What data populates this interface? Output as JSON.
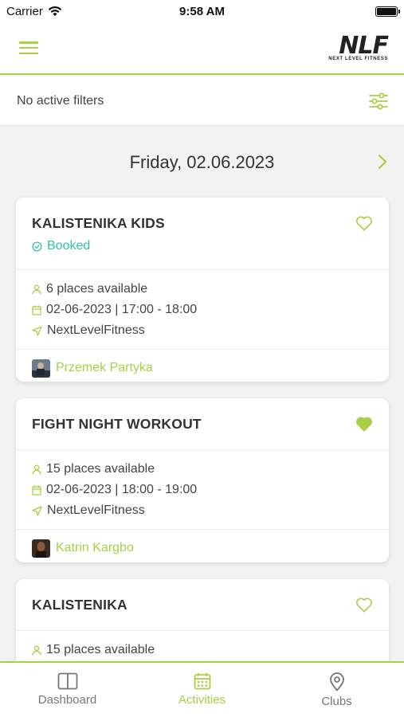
{
  "status_bar": {
    "carrier": "Carrier",
    "time": "9:58 AM"
  },
  "header": {
    "logo_text": "NLF",
    "logo_subtext": "NEXT LEVEL FITNESS"
  },
  "filters": {
    "label": "No active filters"
  },
  "date": {
    "label": "Friday, 02.06.2023"
  },
  "colors": {
    "accent": "#a8cf45",
    "booked": "#2ec4a4"
  },
  "cards": [
    {
      "title": "KALISTENIKA KIDS",
      "status": "Booked",
      "favorite": false,
      "places": "6 places available",
      "datetime": "02-06-2023 | 17:00 - 18:00",
      "location": "NextLevelFitness",
      "trainer": "Przemek Partyka"
    },
    {
      "title": "FIGHT NIGHT WORKOUT",
      "favorite": true,
      "places": "15 places available",
      "datetime": "02-06-2023 | 18:00 - 19:00",
      "location": "NextLevelFitness",
      "trainer": "Katrin Kargbo"
    },
    {
      "title": "KALISTENIKA",
      "favorite": false,
      "places": "15 places available"
    }
  ],
  "tabs": [
    {
      "label": "Dashboard",
      "icon": "dashboard-icon",
      "active": false
    },
    {
      "label": "Activities",
      "icon": "calendar-icon",
      "active": true
    },
    {
      "label": "Clubs",
      "icon": "location-pin-icon",
      "active": false
    }
  ]
}
